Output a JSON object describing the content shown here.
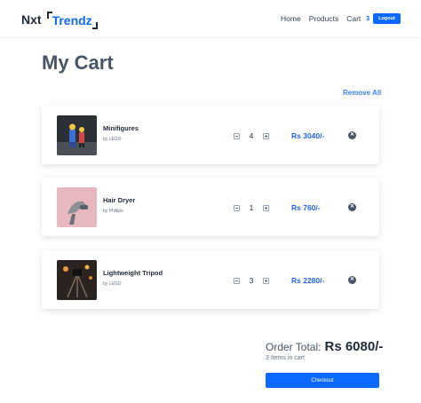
{
  "header": {
    "logo_prefix": "Nxt",
    "logo_name": "Trendz",
    "nav": {
      "home": "Home",
      "products": "Products",
      "cart": "Cart",
      "cart_count": "3"
    },
    "logout_label": "Logout"
  },
  "page": {
    "title": "My Cart",
    "remove_all_label": "Remove All"
  },
  "cart_items": [
    {
      "title": "Minifigures",
      "brand": "by LEGO",
      "quantity": "4",
      "price": "Rs 3040/-",
      "image_icon": "toy-figures-photo"
    },
    {
      "title": "Hair Dryer",
      "brand": "by Phillips",
      "quantity": "1",
      "price": "Rs 760/-",
      "image_icon": "hair-dryer-photo"
    },
    {
      "title": "Lightweight Tripod",
      "brand": "by LEGO",
      "quantity": "3",
      "price": "Rs 2280/-",
      "image_icon": "tripod-photo"
    }
  ],
  "summary": {
    "order_total_label": "Order Total:",
    "order_total_value": "Rs 6080/-",
    "items_count": "3 Items in cart",
    "checkout_label": "Checkout"
  },
  "colors": {
    "accent": "#0b69ff",
    "price": "#2563eb",
    "text": "#1e293b"
  }
}
